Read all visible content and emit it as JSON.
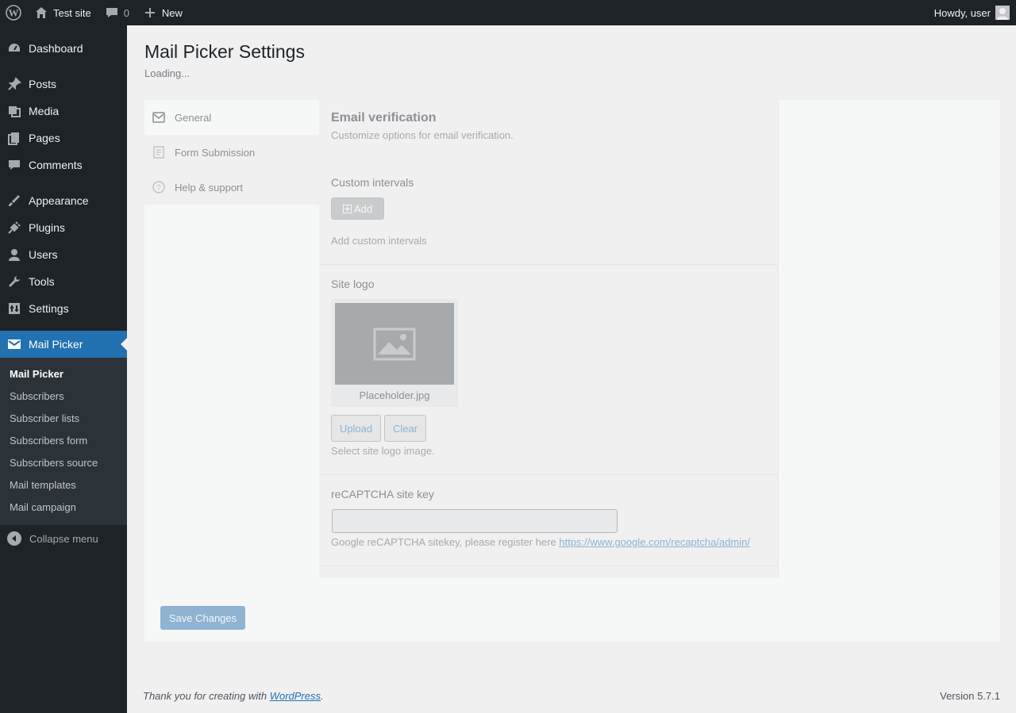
{
  "admin_bar": {
    "site_name": "Test site",
    "comments_count": "0",
    "new_label": "New",
    "greeting": "Howdy, user"
  },
  "sidebar": {
    "items": [
      {
        "label": "Dashboard",
        "icon": "dashboard-icon"
      },
      {
        "label": "Posts",
        "icon": "pin-icon"
      },
      {
        "label": "Media",
        "icon": "media-icon"
      },
      {
        "label": "Pages",
        "icon": "pages-icon"
      },
      {
        "label": "Comments",
        "icon": "comment-icon"
      },
      {
        "label": "Appearance",
        "icon": "brush-icon"
      },
      {
        "label": "Plugins",
        "icon": "plug-icon"
      },
      {
        "label": "Users",
        "icon": "user-icon"
      },
      {
        "label": "Tools",
        "icon": "wrench-icon"
      },
      {
        "label": "Settings",
        "icon": "settings-icon"
      },
      {
        "label": "Mail Picker",
        "icon": "envelope-icon"
      }
    ],
    "submenu": [
      "Mail Picker",
      "Subscribers",
      "Subscriber lists",
      "Subscribers form",
      "Subscribers source",
      "Mail templates",
      "Mail campaign"
    ],
    "collapse_label": "Collapse menu"
  },
  "page": {
    "title": "Mail Picker Settings",
    "status": "Loading..."
  },
  "tabs": [
    {
      "label": "General",
      "icon": "envelope-outline-icon"
    },
    {
      "label": "Form Submission",
      "icon": "form-icon"
    },
    {
      "label": "Help & support",
      "icon": "question-icon"
    }
  ],
  "settings": {
    "section_title": "Email verification",
    "section_desc": "Customize options for email verification.",
    "custom_intervals_label": "Custom intervals",
    "add_button": "Add",
    "custom_intervals_help": "Add custom intervals",
    "site_logo_label": "Site logo",
    "logo_filename": "Placeholder.jpg",
    "upload_button": "Upload",
    "clear_button": "Clear",
    "site_logo_help": "Select site logo image.",
    "recaptcha_label": "reCAPTCHA site key",
    "recaptcha_value": "",
    "recaptcha_help_prefix": "Google reCAPTCHA sitekey, please register here",
    "recaptcha_link": "https://www.google.com/recaptcha/admin/"
  },
  "save_button": "Save Changes",
  "footer": {
    "thanks_prefix": "Thank you for creating with",
    "wordpress_link": "WordPress",
    "thanks_suffix": ".",
    "version": "Version 5.7.1"
  },
  "colors": {
    "adminbar_bg": "#1d2327",
    "accent": "#2271b1",
    "page_bg": "#f0f0f1"
  }
}
